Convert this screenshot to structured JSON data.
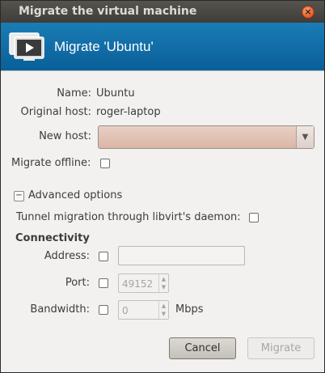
{
  "window": {
    "title": "Migrate the virtual machine",
    "close_glyph": "×"
  },
  "header": {
    "title": "Migrate 'Ubuntu'",
    "icon": "virtual-machine-monitor-icon"
  },
  "details": {
    "name_label": "Name:",
    "name_value": "Ubuntu",
    "original_host_label": "Original host:",
    "original_host_value": "roger-laptop",
    "new_host_label": "New host:",
    "new_host_value": "",
    "migrate_offline_label": "Migrate offline:"
  },
  "advanced": {
    "expander_glyph": "−",
    "label": "Advanced options",
    "tunnel_label": "Tunnel migration through libvirt's daemon:",
    "connectivity_title": "Connectivity",
    "address_label": "Address:",
    "address_value": "",
    "port_label": "Port:",
    "port_value": "49152",
    "bandwidth_label": "Bandwidth:",
    "bandwidth_value": "0",
    "bandwidth_unit": "Mbps"
  },
  "buttons": {
    "cancel": "Cancel",
    "migrate": "Migrate"
  },
  "colors": {
    "header_blue": "#0e68a6",
    "close_orange": "#df5a24",
    "combo_tint": "#dbb6a6"
  }
}
